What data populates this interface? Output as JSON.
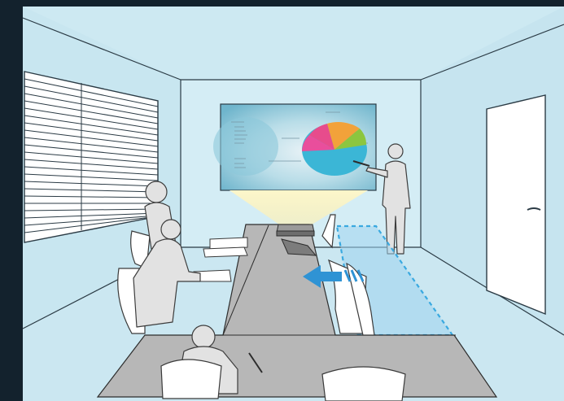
{
  "scene": {
    "colors": {
      "frame": "#13222d",
      "wall": "#cde9f2",
      "table": "#b7b7b7",
      "highlight_zone": "#9fd3ee",
      "arrow": "#2f93d4"
    },
    "icons": [
      "window-blinds-icon",
      "door-icon",
      "projector-icon",
      "move-arrow-icon",
      "pie-chart-icon"
    ]
  }
}
